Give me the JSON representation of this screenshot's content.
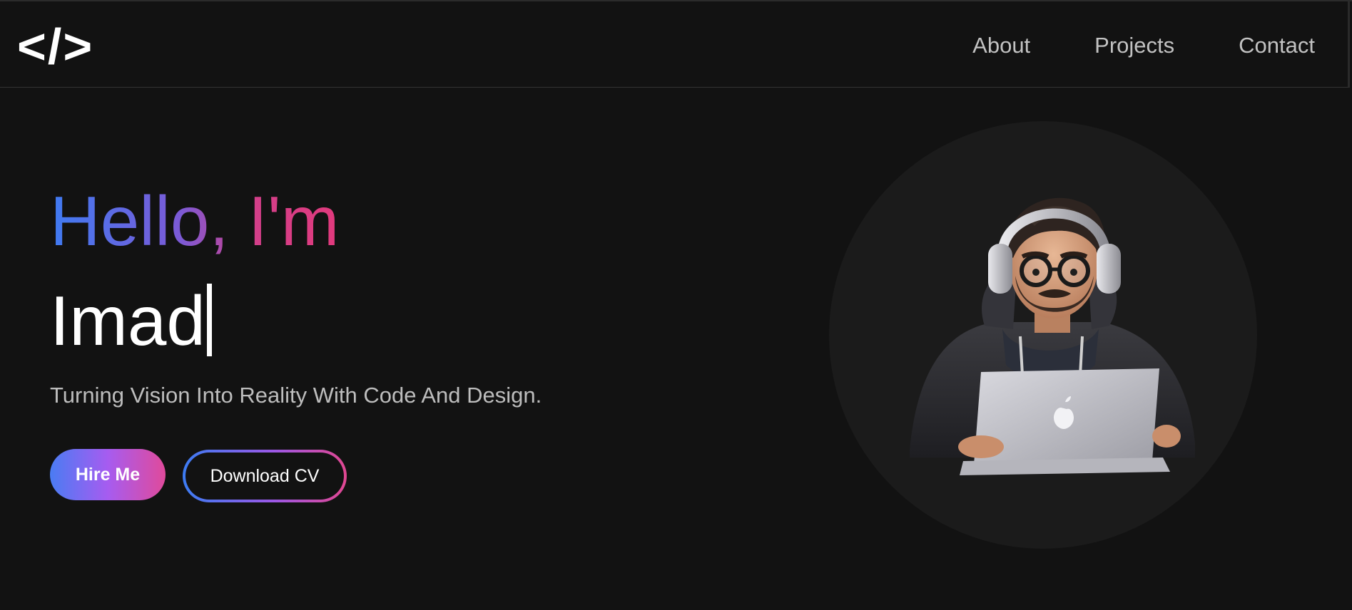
{
  "nav": {
    "logo": "</>",
    "links": [
      "About",
      "Projects",
      "Contact"
    ]
  },
  "hero": {
    "greeting": "Hello, I'm",
    "name": "Imad",
    "tagline": "Turning Vision Into Reality With Code And Design.",
    "hire_label": "Hire Me",
    "cv_label": "Download CV"
  },
  "colors": {
    "background": "#121212",
    "gradient_start": "#3f7bf2",
    "gradient_mid": "#a65cf0",
    "gradient_end": "#e04a9b",
    "avatar_circle": "#1b1b1b"
  },
  "icons": {
    "avatar": "developer-with-headphones-and-laptop-illustration"
  }
}
